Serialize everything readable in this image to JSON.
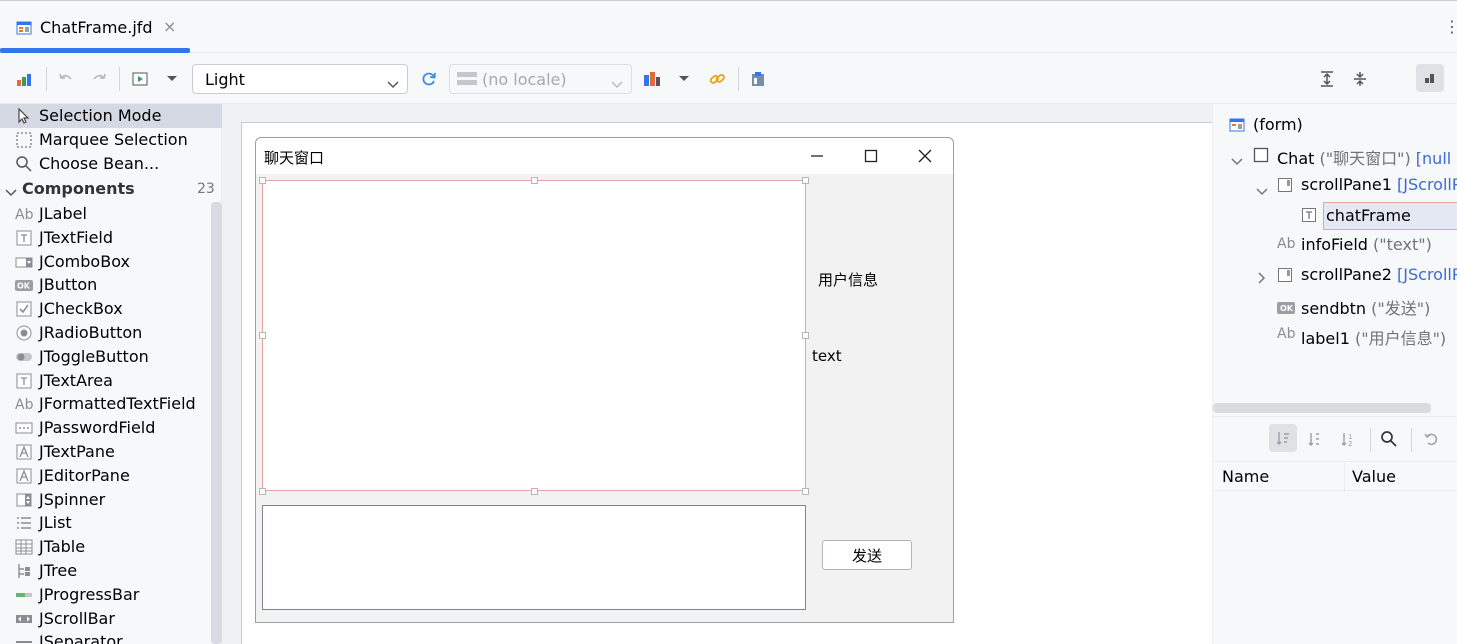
{
  "tab": {
    "title": "ChatFrame.jfd",
    "close": "×"
  },
  "toolbar": {
    "theme": "Light",
    "locale": "(no locale)"
  },
  "palette": {
    "modes": [
      "Selection Mode",
      "Marquee Selection",
      "Choose Bean..."
    ],
    "components_label": "Components",
    "components_count": "23",
    "items": [
      {
        "label": "JLabel",
        "icon": "Ab"
      },
      {
        "label": "JTextField",
        "icon": "T"
      },
      {
        "label": "JComboBox",
        "icon": "combo"
      },
      {
        "label": "JButton",
        "icon": "OK"
      },
      {
        "label": "JCheckBox",
        "icon": "check"
      },
      {
        "label": "JRadioButton",
        "icon": "radio"
      },
      {
        "label": "JToggleButton",
        "icon": "toggle"
      },
      {
        "label": "JTextArea",
        "icon": "T"
      },
      {
        "label": "JFormattedTextField",
        "icon": "Ab"
      },
      {
        "label": "JPasswordField",
        "icon": "dots"
      },
      {
        "label": "JTextPane",
        "icon": "A"
      },
      {
        "label": "JEditorPane",
        "icon": "A"
      },
      {
        "label": "JSpinner",
        "icon": "spinner"
      },
      {
        "label": "JList",
        "icon": "list"
      },
      {
        "label": "JTable",
        "icon": "table"
      },
      {
        "label": "JTree",
        "icon": "tree"
      },
      {
        "label": "JProgressBar",
        "icon": "progress"
      },
      {
        "label": "JScrollBar",
        "icon": "scrollbar"
      },
      {
        "label": "JSeparator",
        "icon": "separator"
      }
    ]
  },
  "form": {
    "window_title": "聊天窗口",
    "user_label": "用户信息",
    "info_text": "text",
    "send_button": "发送"
  },
  "tree": {
    "root": "(form)",
    "chat_name": "Chat",
    "chat_detail": "(\"聊天窗口\")",
    "chat_extra": "[null L",
    "scrollPane1": "scrollPane1",
    "scrollPane1_type": "[JScrollP",
    "chatFrame": "chatFrame",
    "infoField": "infoField",
    "infoField_detail": "(\"text\")",
    "scrollPane2": "scrollPane2",
    "scrollPane2_type": "[JScrollP",
    "sendbtn": "sendbtn",
    "sendbtn_detail": "(\"发送\")",
    "label1": "label1",
    "label1_detail": "(\"用户信息\")"
  },
  "properties": {
    "col_name": "Name",
    "col_value": "Value"
  }
}
